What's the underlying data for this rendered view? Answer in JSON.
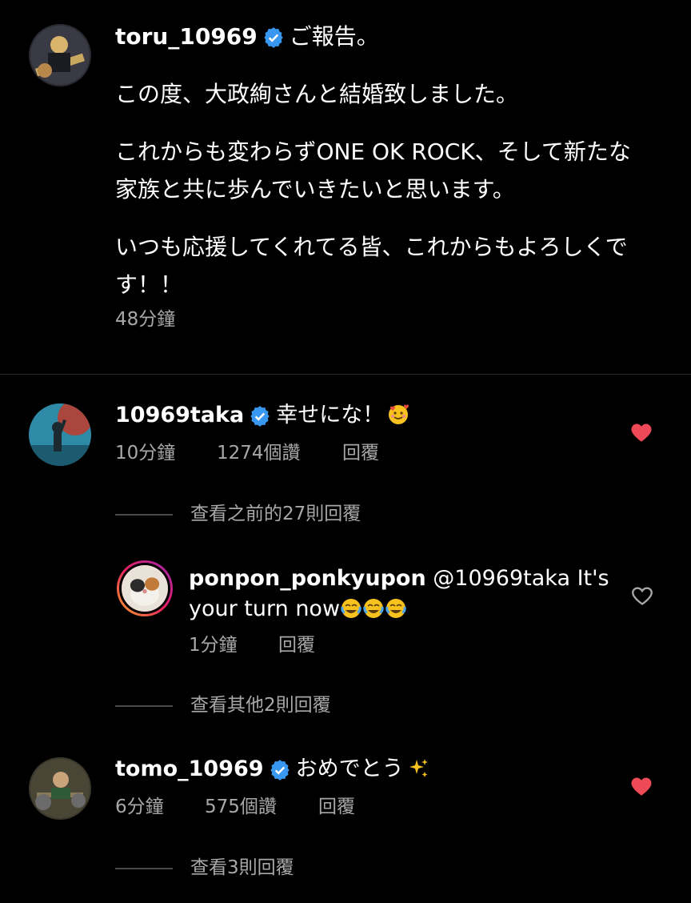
{
  "post": {
    "username": "toru_10969",
    "title": "ご報告。",
    "paragraphs": [
      "この度、大政絢さんと結婚致しました。",
      "これからも変わらずONE OK ROCK、そして新たな家族と共に歩んでいきたいと思います。",
      "いつも応援してくれてる皆、これからもよろしくです！！"
    ],
    "time": "48分鐘"
  },
  "comments": [
    {
      "username": "10969taka",
      "text": "幸せにな！",
      "emoji": "smiling-face-with-hearts",
      "time": "10分鐘",
      "likes": "1274個讚",
      "reply_label": "回覆",
      "liked": true,
      "view_replies": "查看之前的27則回覆",
      "replies": [
        {
          "username": "ponpon_ponkyupon",
          "text": "@10969taka It's your turn now",
          "emoji": "tears-of-joy x3",
          "time": "1分鐘",
          "reply_label": "回覆",
          "liked": false
        }
      ],
      "view_more_replies": "查看其他2則回覆"
    },
    {
      "username": "tomo_10969",
      "text": "おめでとう",
      "emoji": "sparkles",
      "time": "6分鐘",
      "likes": "575個讚",
      "reply_label": "回覆",
      "liked": true,
      "view_replies": "查看3則回覆"
    }
  ],
  "colors": {
    "background": "#000000",
    "text": "#ffffff",
    "muted": "#a8a8a8",
    "verified": "#3897f0",
    "heart": "#ed4956"
  }
}
